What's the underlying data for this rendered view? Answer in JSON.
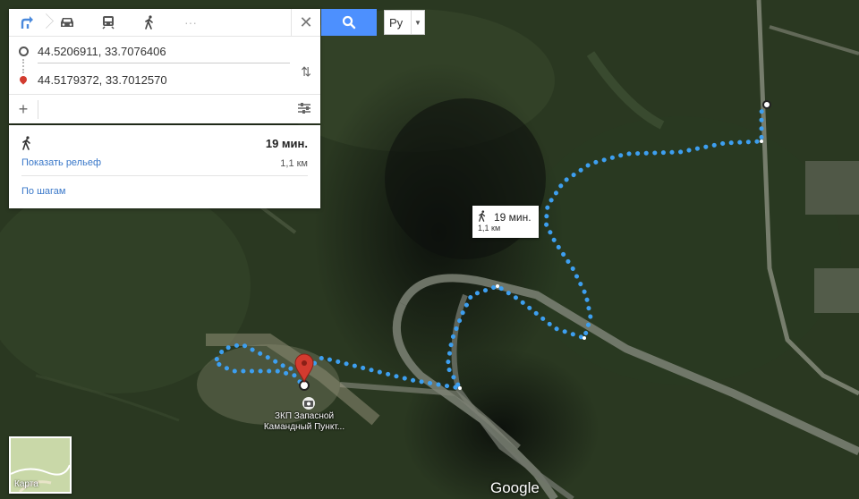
{
  "modes": {
    "directions_icon": "directions-icon",
    "car_icon": "car-icon",
    "transit_icon": "train-icon",
    "walk_icon": "walk-icon",
    "more": "···",
    "close": "✕"
  },
  "origin": "44.5206911, 33.7076406",
  "destination": "44.5179372, 33.7012570",
  "add_label": "+",
  "search_icon": "search-icon",
  "language": "Ру",
  "result": {
    "time": "19 мин.",
    "distance": "1,1 км",
    "relief_link": "Показать рельеф",
    "steps_link": "По шагам"
  },
  "callout": {
    "time": "19 мин.",
    "distance": "1,1 км"
  },
  "poi_label_1": "ЗКП Запасной",
  "poi_label_2": "Камандный Пункт...",
  "minimap_label": "Карта",
  "google_logo": "Google",
  "colors": {
    "route": "#3d9ff0",
    "search_button": "#4d90fe",
    "pin": "#d23b2f"
  }
}
